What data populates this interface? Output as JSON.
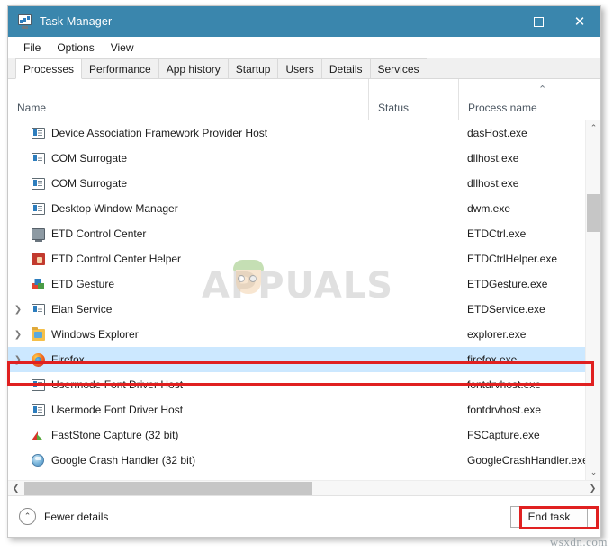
{
  "window": {
    "title": "Task Manager",
    "icon": "task-manager-icon",
    "controls": {
      "minimize": "—",
      "maximize": "□",
      "close": "✕"
    },
    "titlebar_color": "#3a86ad"
  },
  "menubar": {
    "items": [
      {
        "label": "File"
      },
      {
        "label": "Options"
      },
      {
        "label": "View"
      }
    ]
  },
  "tabs": [
    {
      "label": "Processes",
      "active": true
    },
    {
      "label": "Performance",
      "active": false
    },
    {
      "label": "App history",
      "active": false
    },
    {
      "label": "Startup",
      "active": false
    },
    {
      "label": "Users",
      "active": false
    },
    {
      "label": "Details",
      "active": false
    },
    {
      "label": "Services",
      "active": false
    }
  ],
  "table": {
    "columns": [
      {
        "label": "Name",
        "sort": ""
      },
      {
        "label": "Status",
        "sort": ""
      },
      {
        "label": "Process name",
        "sort": "ascending"
      }
    ],
    "sort_arrow_glyph": "⌃",
    "expander_glyph": "❯",
    "rows": [
      {
        "name": "Device Association Framework Provider Host",
        "status": "",
        "process": "dasHost.exe",
        "icon": "generic-app-icon",
        "expandable": false,
        "selected": false
      },
      {
        "name": "COM Surrogate",
        "status": "",
        "process": "dllhost.exe",
        "icon": "generic-app-icon",
        "expandable": false,
        "selected": false
      },
      {
        "name": "COM Surrogate",
        "status": "",
        "process": "dllhost.exe",
        "icon": "generic-app-icon",
        "expandable": false,
        "selected": false
      },
      {
        "name": "Desktop Window Manager",
        "status": "",
        "process": "dwm.exe",
        "icon": "generic-app-icon",
        "expandable": false,
        "selected": false
      },
      {
        "name": "ETD Control Center",
        "status": "",
        "process": "ETDCtrl.exe",
        "icon": "monitor-icon",
        "expandable": false,
        "selected": false
      },
      {
        "name": "ETD Control Center Helper",
        "status": "",
        "process": "ETDCtrlHelper.exe",
        "icon": "hand-touch-icon",
        "expandable": false,
        "selected": false
      },
      {
        "name": "ETD Gesture",
        "status": "",
        "process": "ETDGesture.exe",
        "icon": "blocks-icon",
        "expandable": false,
        "selected": false
      },
      {
        "name": "Elan Service",
        "status": "",
        "process": "ETDService.exe",
        "icon": "generic-app-icon",
        "expandable": true,
        "selected": false
      },
      {
        "name": "Windows Explorer",
        "status": "",
        "process": "explorer.exe",
        "icon": "folder-icon",
        "expandable": true,
        "selected": false
      },
      {
        "name": "Firefox",
        "status": "",
        "process": "firefox.exe",
        "icon": "firefox-icon",
        "expandable": true,
        "selected": true
      },
      {
        "name": "Usermode Font Driver Host",
        "status": "",
        "process": "fontdrvhost.exe",
        "icon": "generic-app-icon",
        "expandable": false,
        "selected": false
      },
      {
        "name": "Usermode Font Driver Host",
        "status": "",
        "process": "fontdrvhost.exe",
        "icon": "generic-app-icon",
        "expandable": false,
        "selected": false
      },
      {
        "name": "FastStone Capture (32 bit)",
        "status": "",
        "process": "FSCapture.exe",
        "icon": "faststone-icon",
        "expandable": false,
        "selected": false
      },
      {
        "name": "Google Crash Handler (32 bit)",
        "status": "",
        "process": "GoogleCrashHandler.exe",
        "icon": "google-crash-icon",
        "expandable": false,
        "selected": false
      }
    ]
  },
  "scrollbars": {
    "vertical": {
      "up_glyph": "⌃",
      "down_glyph": "⌄"
    },
    "horizontal": {
      "left_glyph": "❮",
      "right_glyph": "❯"
    }
  },
  "statusbar": {
    "fewer_details_label": "Fewer details",
    "fewer_details_glyph": "⌃",
    "end_task_label": "End task"
  },
  "annotations": {
    "color": "#e02020",
    "boxes": [
      {
        "target": "firefox-row"
      },
      {
        "target": "end-task-button"
      }
    ]
  },
  "watermarks": {
    "center": "APPUALS",
    "corner": "wsxdn.com"
  }
}
